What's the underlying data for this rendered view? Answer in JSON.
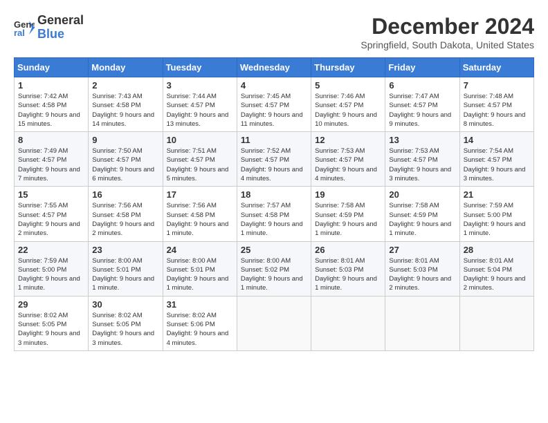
{
  "app": {
    "name_general": "General",
    "name_blue": "Blue"
  },
  "header": {
    "month_title": "December 2024",
    "location": "Springfield, South Dakota, United States"
  },
  "days_of_week": [
    "Sunday",
    "Monday",
    "Tuesday",
    "Wednesday",
    "Thursday",
    "Friday",
    "Saturday"
  ],
  "weeks": [
    [
      {
        "day": "1",
        "sunrise": "7:42 AM",
        "sunset": "4:58 PM",
        "daylight": "9 hours and 15 minutes."
      },
      {
        "day": "2",
        "sunrise": "7:43 AM",
        "sunset": "4:58 PM",
        "daylight": "9 hours and 14 minutes."
      },
      {
        "day": "3",
        "sunrise": "7:44 AM",
        "sunset": "4:57 PM",
        "daylight": "9 hours and 13 minutes."
      },
      {
        "day": "4",
        "sunrise": "7:45 AM",
        "sunset": "4:57 PM",
        "daylight": "9 hours and 11 minutes."
      },
      {
        "day": "5",
        "sunrise": "7:46 AM",
        "sunset": "4:57 PM",
        "daylight": "9 hours and 10 minutes."
      },
      {
        "day": "6",
        "sunrise": "7:47 AM",
        "sunset": "4:57 PM",
        "daylight": "9 hours and 9 minutes."
      },
      {
        "day": "7",
        "sunrise": "7:48 AM",
        "sunset": "4:57 PM",
        "daylight": "9 hours and 8 minutes."
      }
    ],
    [
      {
        "day": "8",
        "sunrise": "7:49 AM",
        "sunset": "4:57 PM",
        "daylight": "9 hours and 7 minutes."
      },
      {
        "day": "9",
        "sunrise": "7:50 AM",
        "sunset": "4:57 PM",
        "daylight": "9 hours and 6 minutes."
      },
      {
        "day": "10",
        "sunrise": "7:51 AM",
        "sunset": "4:57 PM",
        "daylight": "9 hours and 5 minutes."
      },
      {
        "day": "11",
        "sunrise": "7:52 AM",
        "sunset": "4:57 PM",
        "daylight": "9 hours and 4 minutes."
      },
      {
        "day": "12",
        "sunrise": "7:53 AM",
        "sunset": "4:57 PM",
        "daylight": "9 hours and 4 minutes."
      },
      {
        "day": "13",
        "sunrise": "7:53 AM",
        "sunset": "4:57 PM",
        "daylight": "9 hours and 3 minutes."
      },
      {
        "day": "14",
        "sunrise": "7:54 AM",
        "sunset": "4:57 PM",
        "daylight": "9 hours and 3 minutes."
      }
    ],
    [
      {
        "day": "15",
        "sunrise": "7:55 AM",
        "sunset": "4:57 PM",
        "daylight": "9 hours and 2 minutes."
      },
      {
        "day": "16",
        "sunrise": "7:56 AM",
        "sunset": "4:58 PM",
        "daylight": "9 hours and 2 minutes."
      },
      {
        "day": "17",
        "sunrise": "7:56 AM",
        "sunset": "4:58 PM",
        "daylight": "9 hours and 1 minute."
      },
      {
        "day": "18",
        "sunrise": "7:57 AM",
        "sunset": "4:58 PM",
        "daylight": "9 hours and 1 minute."
      },
      {
        "day": "19",
        "sunrise": "7:58 AM",
        "sunset": "4:59 PM",
        "daylight": "9 hours and 1 minute."
      },
      {
        "day": "20",
        "sunrise": "7:58 AM",
        "sunset": "4:59 PM",
        "daylight": "9 hours and 1 minute."
      },
      {
        "day": "21",
        "sunrise": "7:59 AM",
        "sunset": "5:00 PM",
        "daylight": "9 hours and 1 minute."
      }
    ],
    [
      {
        "day": "22",
        "sunrise": "7:59 AM",
        "sunset": "5:00 PM",
        "daylight": "9 hours and 1 minute."
      },
      {
        "day": "23",
        "sunrise": "8:00 AM",
        "sunset": "5:01 PM",
        "daylight": "9 hours and 1 minute."
      },
      {
        "day": "24",
        "sunrise": "8:00 AM",
        "sunset": "5:01 PM",
        "daylight": "9 hours and 1 minute."
      },
      {
        "day": "25",
        "sunrise": "8:00 AM",
        "sunset": "5:02 PM",
        "daylight": "9 hours and 1 minute."
      },
      {
        "day": "26",
        "sunrise": "8:01 AM",
        "sunset": "5:03 PM",
        "daylight": "9 hours and 1 minute."
      },
      {
        "day": "27",
        "sunrise": "8:01 AM",
        "sunset": "5:03 PM",
        "daylight": "9 hours and 2 minutes."
      },
      {
        "day": "28",
        "sunrise": "8:01 AM",
        "sunset": "5:04 PM",
        "daylight": "9 hours and 2 minutes."
      }
    ],
    [
      {
        "day": "29",
        "sunrise": "8:02 AM",
        "sunset": "5:05 PM",
        "daylight": "9 hours and 3 minutes."
      },
      {
        "day": "30",
        "sunrise": "8:02 AM",
        "sunset": "5:05 PM",
        "daylight": "9 hours and 3 minutes."
      },
      {
        "day": "31",
        "sunrise": "8:02 AM",
        "sunset": "5:06 PM",
        "daylight": "9 hours and 4 minutes."
      },
      null,
      null,
      null,
      null
    ]
  ]
}
